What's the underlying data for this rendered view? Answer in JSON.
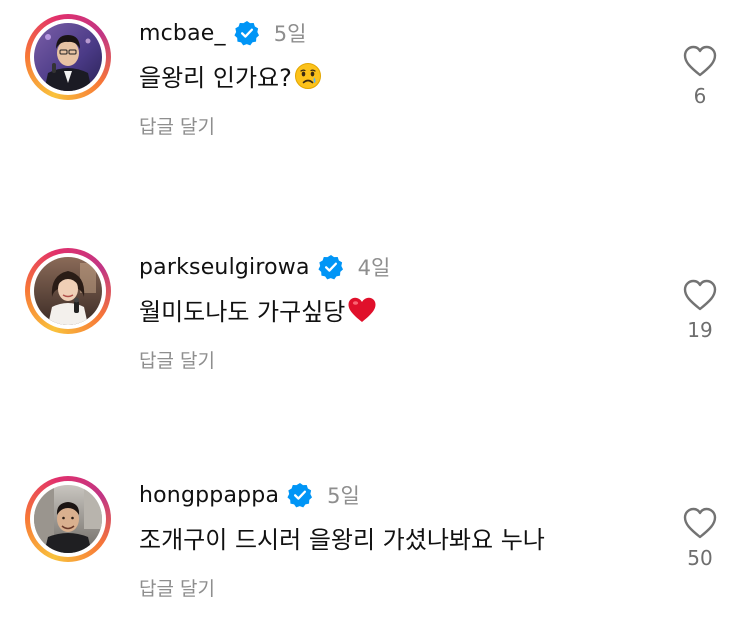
{
  "comments": [
    {
      "username": "mcbae_",
      "time": "5일",
      "text": "을왕리 인가요?",
      "emoji": "crying-face",
      "reply_label": "답글 달기",
      "likes": "6"
    },
    {
      "username": "parkseulgirowa",
      "time": "4일",
      "text": "월미도나도 가구싶당",
      "emoji": "red-heart",
      "reply_label": "답글 달기",
      "likes": "19"
    },
    {
      "username": "hongppappa",
      "time": "5일",
      "text": "조개구이 드시러 을왕리 가셨나봐요 누나",
      "emoji": "",
      "reply_label": "답글 달기",
      "likes": "50"
    }
  ],
  "colors": {
    "verified": "#0095f6",
    "secondary_text": "#8e8e8e",
    "heart_emoji": "#e0102b"
  }
}
